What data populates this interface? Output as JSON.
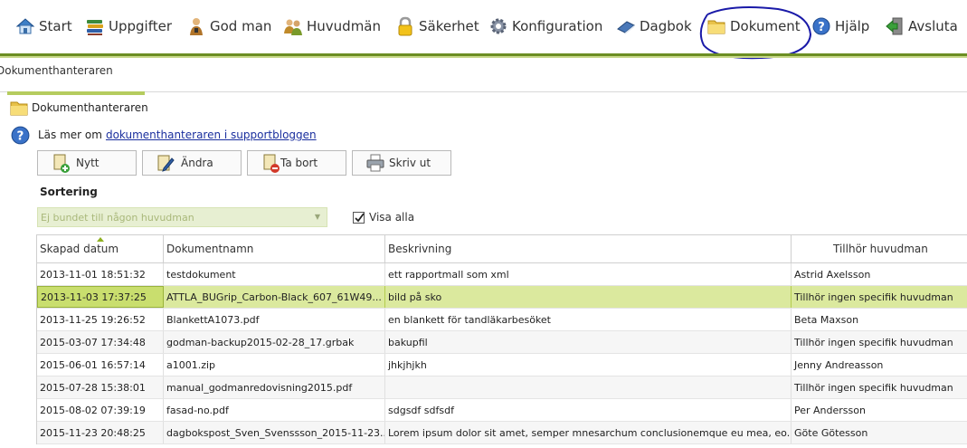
{
  "nav": {
    "items": [
      {
        "label": "Start",
        "icon": "home-icon"
      },
      {
        "label": "Uppgifter",
        "icon": "books-icon"
      },
      {
        "label": "God man",
        "icon": "person-icon"
      },
      {
        "label": "Huvudmän",
        "icon": "people-icon"
      },
      {
        "label": "Säkerhet",
        "icon": "lock-icon"
      },
      {
        "label": "Konfiguration",
        "icon": "gear-icon"
      },
      {
        "label": "Dagbok",
        "icon": "book-icon"
      },
      {
        "label": "Dokument",
        "icon": "folder-icon"
      },
      {
        "label": "Hjälp",
        "icon": "help-icon"
      },
      {
        "label": "Avsluta",
        "icon": "exit-icon"
      }
    ]
  },
  "breadcrumb": "Dokumenthanteraren",
  "section_title": "Dokumenthanteraren",
  "info": {
    "prefix": "Läs mer om",
    "link": "dokumenthanteraren i supportbloggen"
  },
  "toolbar": {
    "new_label": "Nytt",
    "edit_label": "Ändra",
    "delete_label": "Ta bort",
    "print_label": "Skriv ut"
  },
  "sort": {
    "label": "Sortering",
    "selected": "Ej bundet till någon huvudman",
    "show_all_label": "Visa alla",
    "show_all_checked": true
  },
  "table": {
    "columns": [
      "Skapad datum",
      "Dokumentnamn",
      "Beskrivning",
      "Tillhör huvudman"
    ],
    "rows": [
      [
        "2013-11-01 18:51:32",
        "testdokument",
        "ett rapportmall som xml",
        "Astrid Axelsson"
      ],
      [
        "2013-11-03 17:37:25",
        "ATTLA_BUGrip_Carbon-Black_607_61W49...",
        "bild på sko",
        "Tillhör ingen specifik huvudman"
      ],
      [
        "2013-11-25 19:26:52",
        "BlankettA1073.pdf",
        "en blankett för tandläkarbesöket",
        "Beta Maxson"
      ],
      [
        "2015-03-07 17:34:48",
        "godman-backup2015-02-28_17.grbak",
        "bakupfil",
        "Tillhör ingen specifik huvudman"
      ],
      [
        "2015-06-01 16:57:14",
        "a1001.zip",
        "jhkjhjkh",
        "Jenny Andreasson"
      ],
      [
        "2015-07-28 15:38:01",
        "manual_godmanredovisning2015.pdf",
        "",
        "Tillhör ingen specifik huvudman"
      ],
      [
        "2015-08-02 07:39:19",
        "fasad-no.pdf",
        "sdgsdf sdfsdf",
        "Per Andersson"
      ],
      [
        "2015-11-23 20:48:25",
        "dagbokspost_Sven_Svenssson_2015-11-23...",
        "Lorem ipsum dolor sit amet, semper mnesarchum conclusionemque eu mea, eo...",
        "Göte Götesson"
      ]
    ],
    "selected_row": 1
  },
  "colors": {
    "accent_green": "#6b8e23",
    "selected_row": "#dbe99e",
    "link": "#1a2f9e",
    "annotation_circle": "#1a1aa8"
  }
}
